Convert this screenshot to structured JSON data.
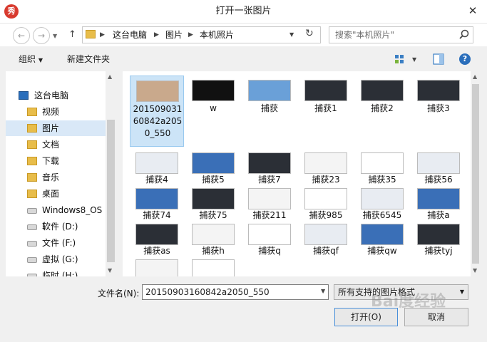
{
  "window": {
    "title": "打开一张图片",
    "close_glyph": "✕",
    "app_icon_text": "秀"
  },
  "nav": {
    "back_glyph": "←",
    "forward_glyph": "→",
    "up_glyph": "↑",
    "breadcrumbs": [
      "这台电脑",
      "图片",
      "本机照片"
    ],
    "search_placeholder": "搜索\"本机照片\""
  },
  "toolbar": {
    "organize": "组织",
    "new_folder": "新建文件夹"
  },
  "sidebar": {
    "items": [
      {
        "label": "这台电脑",
        "icon": "computer-icon"
      },
      {
        "label": "视频",
        "icon": "folder-icon"
      },
      {
        "label": "图片",
        "icon": "folder-icon"
      },
      {
        "label": "文档",
        "icon": "folder-icon"
      },
      {
        "label": "下载",
        "icon": "folder-icon"
      },
      {
        "label": "音乐",
        "icon": "folder-icon"
      },
      {
        "label": "桌面",
        "icon": "folder-icon"
      },
      {
        "label": "Windows8_OS (",
        "icon": "drive-icon"
      },
      {
        "label": "软件 (D:)",
        "icon": "drive-icon"
      },
      {
        "label": "文件  (F:)",
        "icon": "drive-icon"
      },
      {
        "label": "虚拟 (G:)",
        "icon": "drive-icon"
      },
      {
        "label": "临时 (H:)",
        "icon": "drive-icon"
      }
    ]
  },
  "files": [
    {
      "name": "20150903160842a2050_550"
    },
    {
      "name": "w"
    },
    {
      "name": "捕获"
    },
    {
      "name": "捕获1"
    },
    {
      "name": "捕获2"
    },
    {
      "name": "捕获3"
    },
    {
      "name": "捕获4"
    },
    {
      "name": "捕获5"
    },
    {
      "name": "捕获7"
    },
    {
      "name": "捕获23"
    },
    {
      "name": "捕获35"
    },
    {
      "name": "捕获56"
    },
    {
      "name": "捕获74"
    },
    {
      "name": "捕获75"
    },
    {
      "name": "捕获211"
    },
    {
      "name": "捕获985"
    },
    {
      "name": "捕获6545"
    },
    {
      "name": "捕获a"
    },
    {
      "name": "捕获as"
    },
    {
      "name": "捕获h"
    },
    {
      "name": "捕获q"
    },
    {
      "name": "捕获qf"
    },
    {
      "name": "捕获qw"
    },
    {
      "name": "捕获tyj"
    },
    {
      "name": ""
    },
    {
      "name": ""
    }
  ],
  "bottom": {
    "filename_label": "文件名(N):",
    "filename_value": "20150903160842a2050_550",
    "filetype": "所有支持的图片格式",
    "open_label": "打开(O)",
    "cancel_label": "取消"
  },
  "watermark": "Bai度经验"
}
